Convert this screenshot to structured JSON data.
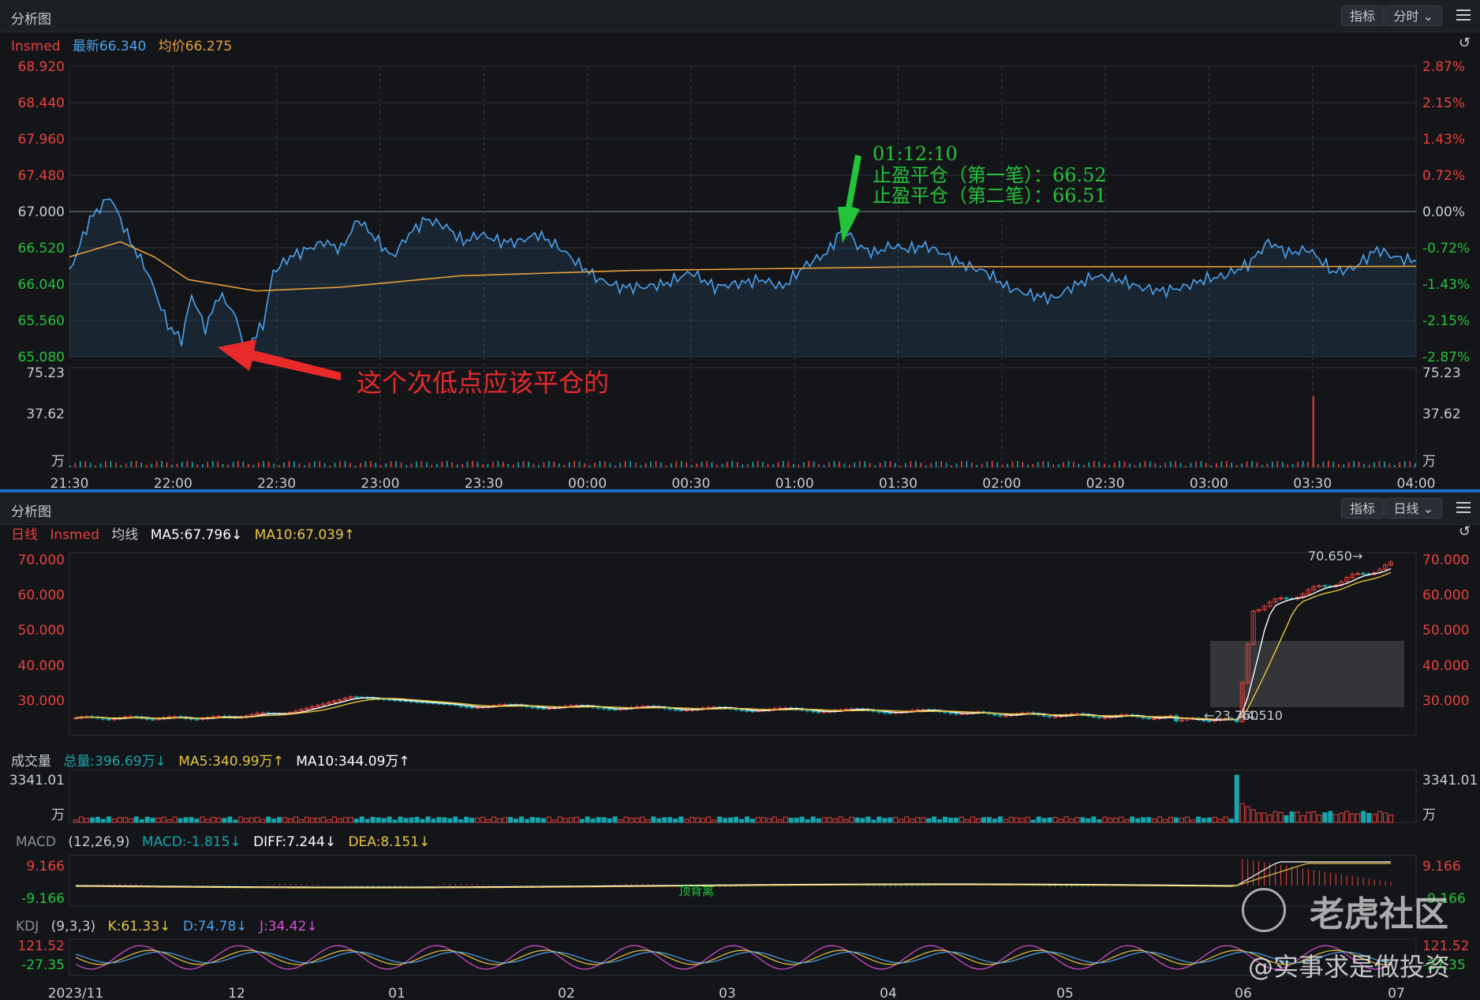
{
  "top_panel": {
    "title": "分析图",
    "btn_indicator": "指标",
    "btn_period": "分时",
    "stock": "Insmed",
    "latest": "最新66.340",
    "avg": "均价66.275",
    "price_ticks": [
      "68.920",
      "68.440",
      "67.960",
      "67.480",
      "67.000",
      "66.520",
      "66.040",
      "65.560",
      "65.080"
    ],
    "pct_ticks": [
      "2.87%",
      "2.15%",
      "1.43%",
      "0.72%",
      "0.00%",
      "-0.72%",
      "-1.43%",
      "-2.15%",
      "-2.87%"
    ],
    "vol_ticks": [
      "75.23",
      "37.62",
      "万"
    ],
    "time_ticks": [
      "21:30",
      "22:00",
      "22:30",
      "23:00",
      "23:30",
      "00:00",
      "00:30",
      "01:00",
      "01:30",
      "02:00",
      "02:30",
      "03:00",
      "03:30",
      "04:00"
    ],
    "annot_green": [
      "01:12:10",
      "止盈平仓（第一笔）：66.52",
      "止盈平仓（第二笔）：66.51"
    ],
    "annot_red": "这个次低点应该平仓的"
  },
  "bottom_panel": {
    "title": "分析图",
    "btn_indicator": "指标",
    "btn_period": "日线",
    "k_info": [
      "日线",
      "Insmed",
      "均线",
      "MA5:67.796↓",
      "MA10:67.039↑"
    ],
    "price_ticks": [
      "70.000",
      "60.000",
      "50.000",
      "40.000",
      "30.000"
    ],
    "high_label": "70.650→",
    "low_label": "←23.760",
    "range_label": "44.510",
    "vol_info": [
      "成交量",
      "总量:396.69万↓",
      "MA5:340.99万↑",
      "MA10:344.09万↑"
    ],
    "vol_ticks": [
      "3341.01",
      "万"
    ],
    "macd_info": [
      "MACD",
      "(12,26,9)",
      "MACD:-1.815↓",
      "DIFF:7.244↓",
      "DEA:8.151↓"
    ],
    "macd_ticks": [
      "9.166",
      "-9.166"
    ],
    "macd_note": "顶背离",
    "kdj_info": [
      "KDJ",
      "(9,3,3)",
      "K:61.33↓",
      "D:74.78↓",
      "J:34.42↓"
    ],
    "kdj_ticks": [
      "121.52",
      "-27.35"
    ],
    "date_ticks": [
      "2023/11",
      "12",
      "01",
      "02",
      "03",
      "04",
      "05",
      "06",
      "07"
    ]
  },
  "watermark": {
    "brand": "老虎社区",
    "handle": "@实事求是做投资"
  },
  "colors": {
    "up": "#e8413c",
    "down": "#15a7b0",
    "price_line": "#4aa3f0",
    "avg_line": "#e9a03a",
    "ma10": "#e9c53a",
    "grid": "#2b2f36"
  },
  "chart_data": [
    {
      "type": "line",
      "title": "分时",
      "x": [
        "21:30",
        "22:00",
        "22:30",
        "23:00",
        "23:30",
        "00:00",
        "00:30",
        "01:00",
        "01:30",
        "02:00",
        "02:30",
        "03:00",
        "03:30",
        "04:00"
      ],
      "series": [
        {
          "name": "最新",
          "values": [
            66.2,
            65.3,
            66.6,
            66.8,
            66.3,
            66.0,
            66.1,
            66.8,
            66.2,
            66.0,
            66.0,
            66.1,
            66.5,
            66.34
          ]
        },
        {
          "name": "均价",
          "values": [
            66.4,
            66.1,
            66.1,
            66.2,
            66.25,
            66.25,
            66.25,
            66.27,
            66.27,
            66.27,
            66.27,
            66.27,
            66.27,
            66.275
          ]
        }
      ],
      "ylim": [
        65.08,
        68.92
      ]
    },
    {
      "type": "line",
      "title": "日线",
      "x": [
        "2023/11",
        "12",
        "01",
        "02",
        "03",
        "04",
        "05",
        "06",
        "07"
      ],
      "series": [
        {
          "name": "MA5",
          "values": [
            25.0,
            26.5,
            31.0,
            28.5,
            28.0,
            27.0,
            25.0,
            55.0,
            67.796
          ]
        },
        {
          "name": "MA10",
          "values": [
            25.0,
            26.0,
            30.0,
            28.5,
            28.0,
            27.0,
            25.5,
            50.0,
            67.039
          ]
        }
      ],
      "ylim": [
        20,
        72
      ]
    }
  ]
}
